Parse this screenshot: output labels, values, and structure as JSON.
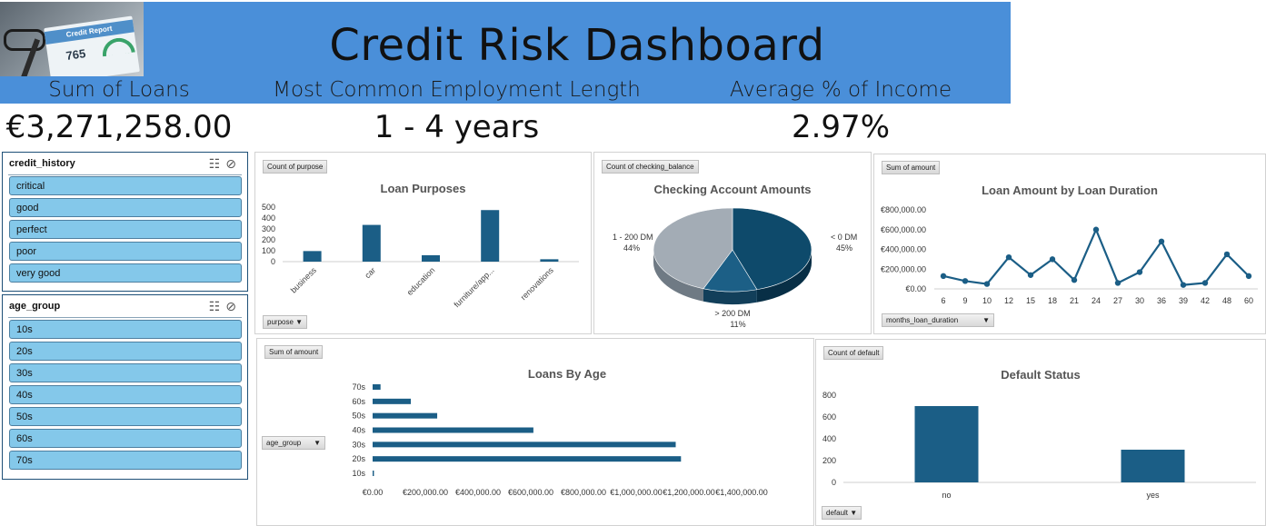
{
  "header": {
    "title": "Credit Risk Dashboard",
    "image_caption": "Credit Report",
    "image_score": "765"
  },
  "kpis": [
    {
      "label": "Sum of Loans",
      "value": "€3,271,258.00"
    },
    {
      "label": "Most Common Employment Length",
      "value": "1 - 4 years"
    },
    {
      "label": "Average % of Income",
      "value": "2.97%"
    }
  ],
  "slicers": {
    "credit_history": {
      "title": "credit_history",
      "items": [
        "critical",
        "good",
        "perfect",
        "poor",
        "very good"
      ]
    },
    "age_group": {
      "title": "age_group",
      "items": [
        "10s",
        "20s",
        "30s",
        "40s",
        "50s",
        "60s",
        "70s"
      ]
    }
  },
  "colors": {
    "banner": "#4a8fd9",
    "bar": "#1b5e86",
    "slicer_item": "#84c8ea"
  },
  "charts": {
    "purposes": {
      "field_button": "Count of purpose",
      "filter_button": "purpose",
      "chart_data": {
        "type": "bar",
        "title": "Loan Purposes",
        "categories": [
          "business",
          "car",
          "education",
          "furniture/app...",
          "renovations"
        ],
        "values": [
          97,
          337,
          59,
          473,
          22
        ],
        "ylim": [
          0,
          500
        ],
        "yticks": [
          "0",
          "100",
          "200",
          "300",
          "400",
          "500"
        ]
      }
    },
    "checking": {
      "field_button": "Count of checking_balance",
      "chart_data": {
        "type": "pie",
        "title": "Checking Account Amounts",
        "slices": [
          {
            "label": "< 0 DM",
            "pct": "45%",
            "value": 45
          },
          {
            "label": "> 200 DM",
            "pct": "11%",
            "value": 11
          },
          {
            "label": "1 - 200 DM",
            "pct": "44%",
            "value": 44
          }
        ]
      }
    },
    "duration": {
      "field_button": "Sum of amount",
      "filter_button": "months_loan_duration",
      "chart_data": {
        "type": "line",
        "title": "Loan Amount by Loan Duration",
        "x": [
          "6",
          "9",
          "10",
          "12",
          "15",
          "18",
          "21",
          "24",
          "27",
          "30",
          "36",
          "39",
          "42",
          "48",
          "60"
        ],
        "values": [
          130000,
          80000,
          50000,
          320000,
          140000,
          300000,
          90000,
          600000,
          60000,
          170000,
          480000,
          40000,
          60000,
          350000,
          130000
        ],
        "ylim": [
          0,
          800000
        ],
        "yticks": [
          "€0.00",
          "€200,000.00",
          "€400,000.00",
          "€600,000.00",
          "€800,000.00"
        ]
      }
    },
    "age": {
      "field_button": "Sum of amount",
      "filter_button": "age_group",
      "chart_data": {
        "type": "bar",
        "title": "Loans By Age",
        "categories": [
          "10s",
          "20s",
          "30s",
          "40s",
          "50s",
          "60s",
          "70s"
        ],
        "values": [
          5000,
          1170000,
          1150000,
          610000,
          245000,
          145000,
          30000
        ],
        "xlim": [
          0,
          1400000
        ],
        "xticks": [
          "€0.00",
          "€200,000.00",
          "€400,000.00",
          "€600,000.00",
          "€800,000.00",
          "€1,000,000.00",
          "€1,200,000.00",
          "€1,400,000.00"
        ]
      }
    },
    "default": {
      "field_button": "Count of default",
      "filter_button": "default",
      "chart_data": {
        "type": "bar",
        "title": "Default Status",
        "categories": [
          "no",
          "yes"
        ],
        "values": [
          700,
          300
        ],
        "ylim": [
          0,
          800
        ],
        "yticks": [
          "0",
          "200",
          "400",
          "600",
          "800"
        ]
      }
    }
  }
}
